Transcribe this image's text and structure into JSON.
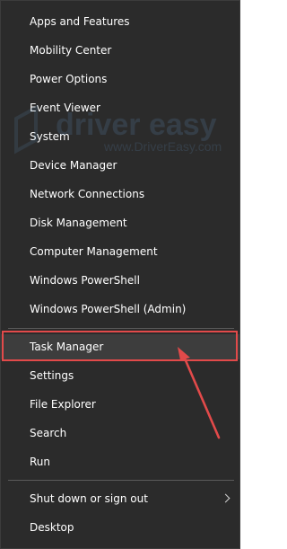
{
  "colors": {
    "menu_bg": "#2b2b2b",
    "text": "#ffffff",
    "separator": "#5a5a5a",
    "annotation": "#e24a4a"
  },
  "menu": {
    "items": [
      {
        "label": "Apps and Features"
      },
      {
        "label": "Mobility Center"
      },
      {
        "label": "Power Options"
      },
      {
        "label": "Event Viewer"
      },
      {
        "label": "System"
      },
      {
        "label": "Device Manager"
      },
      {
        "label": "Network Connections"
      },
      {
        "label": "Disk Management"
      },
      {
        "label": "Computer Management"
      },
      {
        "label": "Windows PowerShell"
      },
      {
        "label": "Windows PowerShell (Admin)"
      },
      {
        "label": "Task Manager"
      },
      {
        "label": "Settings"
      },
      {
        "label": "File Explorer"
      },
      {
        "label": "Search"
      },
      {
        "label": "Run"
      },
      {
        "label": "Shut down or sign out"
      },
      {
        "label": "Desktop"
      }
    ]
  },
  "watermark": {
    "brand": "driver easy",
    "url": "www.DriverEasy.com"
  },
  "icons": {
    "submenu_arrow": "chevron-right-icon",
    "watermark_logo": "driver-easy-logo"
  }
}
